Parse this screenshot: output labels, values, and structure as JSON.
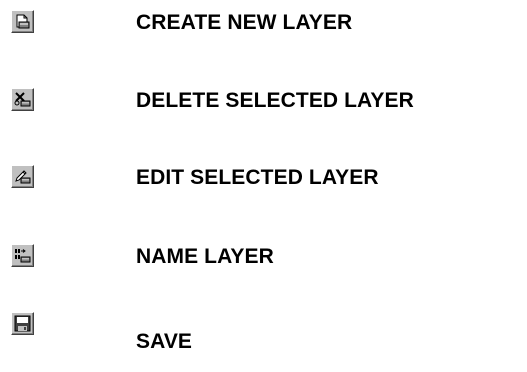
{
  "legend": {
    "items": [
      {
        "icon": "create-new-layer-icon",
        "label": "CREATE NEW LAYER"
      },
      {
        "icon": "delete-selected-layer-icon",
        "label": "DELETE SELECTED LAYER"
      },
      {
        "icon": "edit-selected-layer-icon",
        "label": "EDIT SELECTED LAYER"
      },
      {
        "icon": "name-layer-icon",
        "label": "NAME LAYER"
      },
      {
        "icon": "save-icon",
        "label": "SAVE"
      }
    ]
  },
  "colors": {
    "button_face": "#c0c0c0",
    "text": "#000000",
    "background": "#ffffff"
  }
}
